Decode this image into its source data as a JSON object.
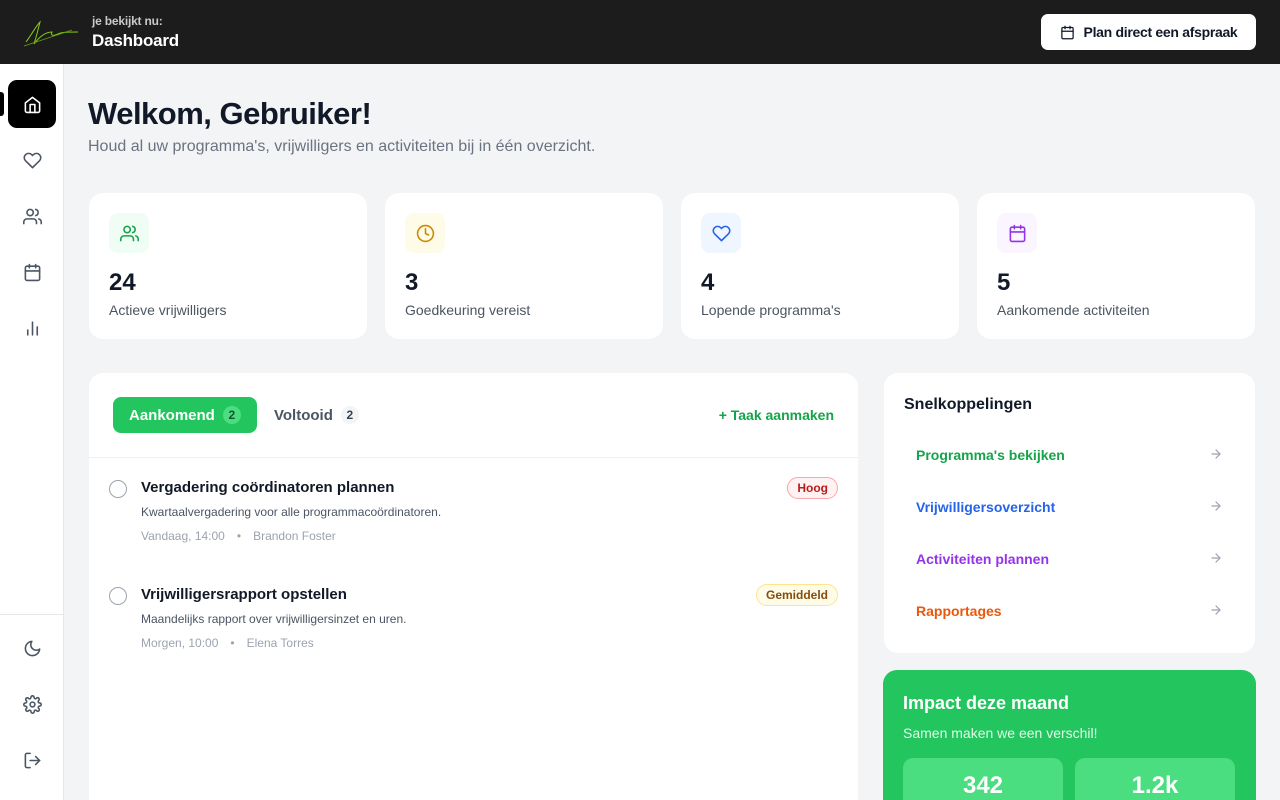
{
  "header": {
    "prefix": "je bekijkt nu:",
    "title": "Dashboard",
    "plan_button": "Plan direct een afspraak"
  },
  "sidebar": {
    "top_items": [
      {
        "icon": "home-icon",
        "active": true
      },
      {
        "icon": "heart-icon",
        "active": false
      },
      {
        "icon": "users-icon",
        "active": false
      },
      {
        "icon": "calendar-icon",
        "active": false
      },
      {
        "icon": "bar-chart-icon",
        "active": false
      }
    ],
    "bottom_items": [
      {
        "icon": "moon-icon"
      },
      {
        "icon": "gear-icon"
      },
      {
        "icon": "logout-icon"
      }
    ]
  },
  "welcome": {
    "title": "Welkom, Gebruiker!",
    "subtitle": "Houd al uw programma's, vrijwilligers en activiteiten bij in één overzicht."
  },
  "stats": [
    {
      "value": "24",
      "label": "Actieve vrijwilligers",
      "icon": "users-icon",
      "color": "#16a34a",
      "bg": "#f0fdf4"
    },
    {
      "value": "3",
      "label": "Goedkeuring vereist",
      "icon": "clock-icon",
      "color": "#ca8a04",
      "bg": "#fefce8"
    },
    {
      "value": "4",
      "label": "Lopende programma's",
      "icon": "heart-icon",
      "color": "#2563eb",
      "bg": "#eff6ff"
    },
    {
      "value": "5",
      "label": "Aankomende activiteiten",
      "icon": "calendar-icon",
      "color": "#9333ea",
      "bg": "#faf5ff"
    }
  ],
  "tasks": {
    "tab_upcoming": "Aankomend",
    "tab_upcoming_count": "2",
    "tab_done": "Voltooid",
    "tab_done_count": "2",
    "add_task": "+ Taak aanmaken",
    "items": [
      {
        "title": "Vergadering coördinatoren plannen",
        "description": "Kwartaalvergadering voor alle programmacoördinatoren.",
        "time": "Vandaag, 14:00",
        "person": "Brandon Foster",
        "priority": "Hoog"
      },
      {
        "title": "Vrijwilligersrapport opstellen",
        "description": "Maandelijks rapport over vrijwilligersinzet en uren.",
        "time": "Morgen, 10:00",
        "person": "Elena Torres",
        "priority": "Gemiddeld"
      }
    ]
  },
  "quick_links": {
    "title": "Snelkoppelingen",
    "items": [
      {
        "label": "Programma's bekijken",
        "color": "#16a34a",
        "bg": "#f0fdf4"
      },
      {
        "label": "Vrijwilligersoverzicht",
        "color": "#2563eb",
        "bg": "#eff6ff"
      },
      {
        "label": "Activiteiten plannen",
        "color": "#9333ea",
        "bg": "#faf5ff"
      },
      {
        "label": "Rapportages",
        "color": "#ea580c",
        "bg": "#fff7ed"
      }
    ]
  },
  "impact": {
    "title": "Impact deze maand",
    "subtitle": "Samen maken we een verschil!",
    "values": [
      "342",
      "1.2k"
    ]
  }
}
